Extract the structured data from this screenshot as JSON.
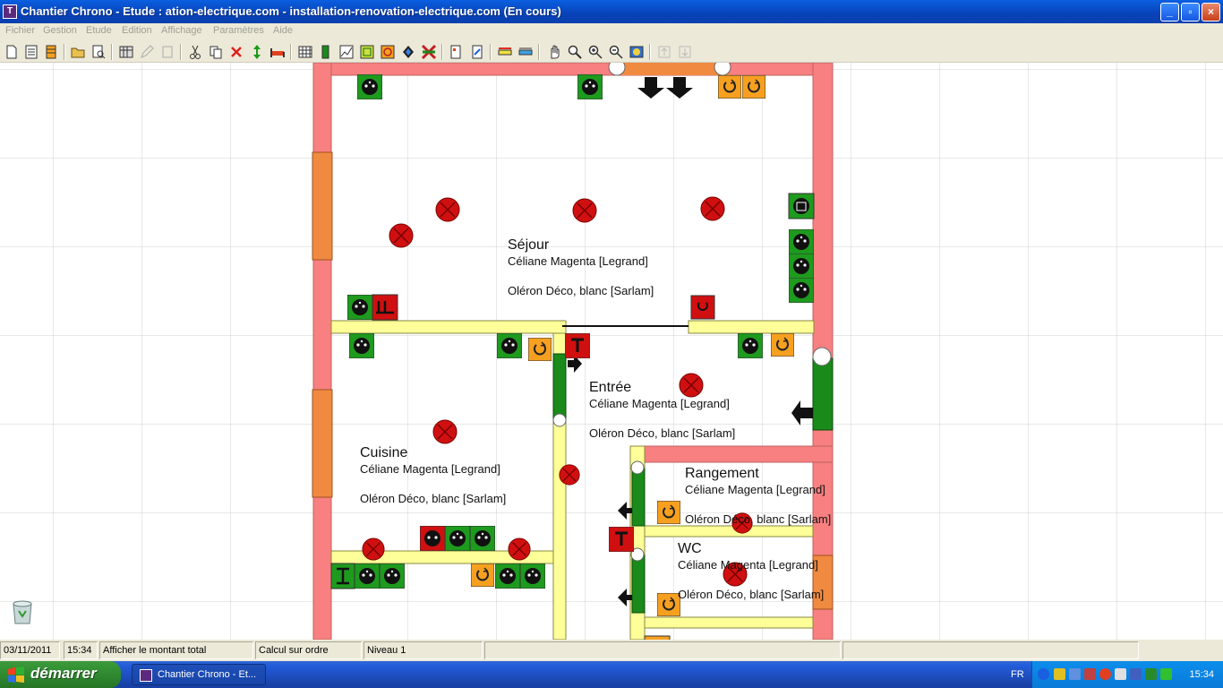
{
  "window": {
    "title": "Chantier Chrono - Etude : ation-electrique.com - installation-renovation-electrique.com (En cours)",
    "minimize": "_",
    "maximize": "▫",
    "close": "×",
    "app_icon_letter": "T"
  },
  "menu": [
    "Fichier",
    "Gestion",
    "Etude",
    "Edition",
    "Affichage",
    "Paramètres",
    "Aide"
  ],
  "toolbar": {
    "icons": [
      "new-document-icon",
      "document-list-icon",
      "stack-icon",
      "open-folder-icon",
      "print-preview-icon",
      "calculator-icon",
      "edit-icon",
      "edit-copy-icon",
      "cut-icon",
      "copy-icon",
      "delete-icon",
      "move-vertical-icon",
      "bed-icon",
      "grid-icon",
      "door-icon",
      "chart-icon",
      "green-square-icon",
      "orange-square-icon",
      "diamond-icon",
      "cross-arrows-icon",
      "page-icon",
      "page-edit-icon",
      "ruler-icon",
      "ruler-alt-icon",
      "hand-icon",
      "zoom-icon",
      "zoom-in-icon",
      "zoom-out-icon",
      "zoom-fit-icon",
      "level-up-icon",
      "level-down-icon"
    ]
  },
  "rooms": [
    {
      "name": "Séjour",
      "line1": "Céliane Magenta [Legrand]",
      "line2": "Oléron Déco, blanc [Sarlam]"
    },
    {
      "name": "Entrée",
      "line1": "Céliane Magenta [Legrand]",
      "line2": "Oléron Déco, blanc [Sarlam]"
    },
    {
      "name": "Cuisine",
      "line1": "Céliane Magenta [Legrand]",
      "line2": "Oléron Déco, blanc [Sarlam]"
    },
    {
      "name": "Rangement",
      "line1": "Céliane Magenta [Legrand]",
      "line2": "Oléron Déco, blanc [Sarlam]"
    },
    {
      "name": "WC",
      "line1": "Céliane Magenta [Legrand]",
      "line2": "Oléron Déco, blanc [Sarlam]"
    }
  ],
  "colors": {
    "wall": "#F88080",
    "window_opening": "#F08A40",
    "partition": "#FFFF99",
    "door": "#1A8A1A",
    "light_point": "#D01010",
    "socket_green": "#1E9A1E",
    "switch_orange": "#F7A020"
  },
  "status": {
    "date": "03/11/2011",
    "time": "15:34",
    "action": "Afficher le montant total",
    "calc": "Calcul sur ordre",
    "level": "Niveau 1"
  },
  "taskbar": {
    "start": "démarrer",
    "app": "Chantier Chrono - Et...",
    "lang": "FR",
    "clock": "15:34"
  }
}
